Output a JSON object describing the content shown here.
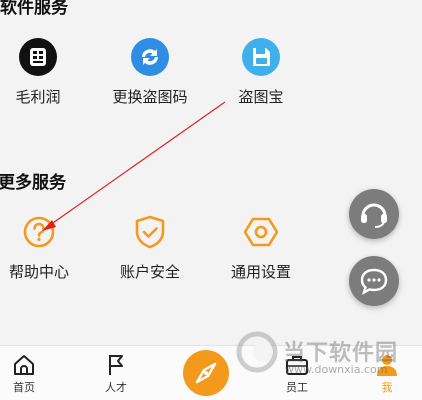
{
  "software_services": {
    "title": "软件服务",
    "items": [
      {
        "label": "毛利润",
        "icon": "calculator-icon",
        "color": "#111111"
      },
      {
        "label": "更换盗图码",
        "icon": "swap-icon",
        "color": "#2f8de4"
      },
      {
        "label": "盗图宝",
        "icon": "floppy-disk-icon",
        "color": "#3fb0ec"
      }
    ]
  },
  "more_services": {
    "title": "更多服务",
    "items": [
      {
        "label": "帮助中心",
        "icon": "help-circle-icon",
        "color": "#f39a1d"
      },
      {
        "label": "账户安全",
        "icon": "shield-check-icon",
        "color": "#f39a1d"
      },
      {
        "label": "通用设置",
        "icon": "hexagon-settings-icon",
        "color": "#f39a1d"
      }
    ]
  },
  "floating_buttons": [
    {
      "icon": "headset-icon"
    },
    {
      "icon": "chat-bubble-icon"
    }
  ],
  "tabbar": {
    "tabs": [
      {
        "label": "首页",
        "icon": "home-icon",
        "active": false
      },
      {
        "label": "人才",
        "icon": "flag-icon",
        "active": false
      },
      {
        "label": "",
        "icon": "compass-icon",
        "active": false
      },
      {
        "label": "员工",
        "icon": "briefcase-icon",
        "active": false
      },
      {
        "label": "我",
        "icon": "person-icon",
        "active": true
      }
    ]
  },
  "watermark": {
    "title": "当下软件园",
    "url": "www.downxia.com"
  },
  "colors": {
    "accent": "#f39a1d",
    "annotation_arrow": "#e02020",
    "background": "#f3f3f3"
  }
}
